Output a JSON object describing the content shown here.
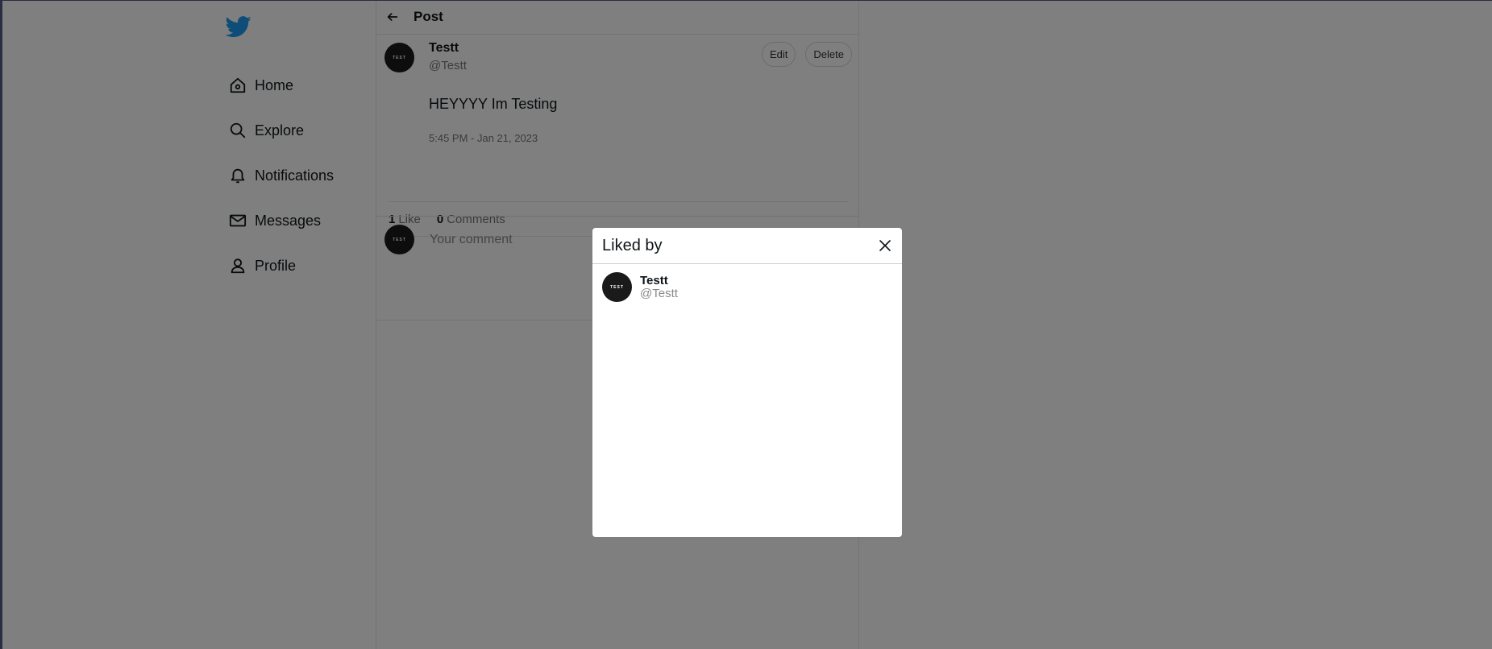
{
  "sidebar": {
    "items": [
      {
        "label": "Home",
        "icon": "home-icon"
      },
      {
        "label": "Explore",
        "icon": "search-icon"
      },
      {
        "label": "Notifications",
        "icon": "bell-icon"
      },
      {
        "label": "Messages",
        "icon": "mail-icon"
      },
      {
        "label": "Profile",
        "icon": "user-icon"
      }
    ]
  },
  "header": {
    "title": "Post"
  },
  "post": {
    "name": "Testt",
    "handle": "@Testt",
    "avatar_text": "TEST",
    "text": "HEYYYY Im Testing",
    "date": "5:45 PM - Jan 21, 2023",
    "edit_label": "Edit",
    "delete_label": "Delete",
    "likes_count": "1",
    "likes_label": "Like",
    "comments_count": "0",
    "comments_label": "Comments"
  },
  "comment": {
    "placeholder": "Your comment",
    "avatar_text": "TEST"
  },
  "modal": {
    "title": "Liked by",
    "likers": [
      {
        "name": "Testt",
        "handle": "@Testt",
        "avatar_text": "TEST"
      }
    ]
  },
  "colors": {
    "brand": "#1d9bf0",
    "overlay": "rgba(0,0,0,0.5)"
  }
}
